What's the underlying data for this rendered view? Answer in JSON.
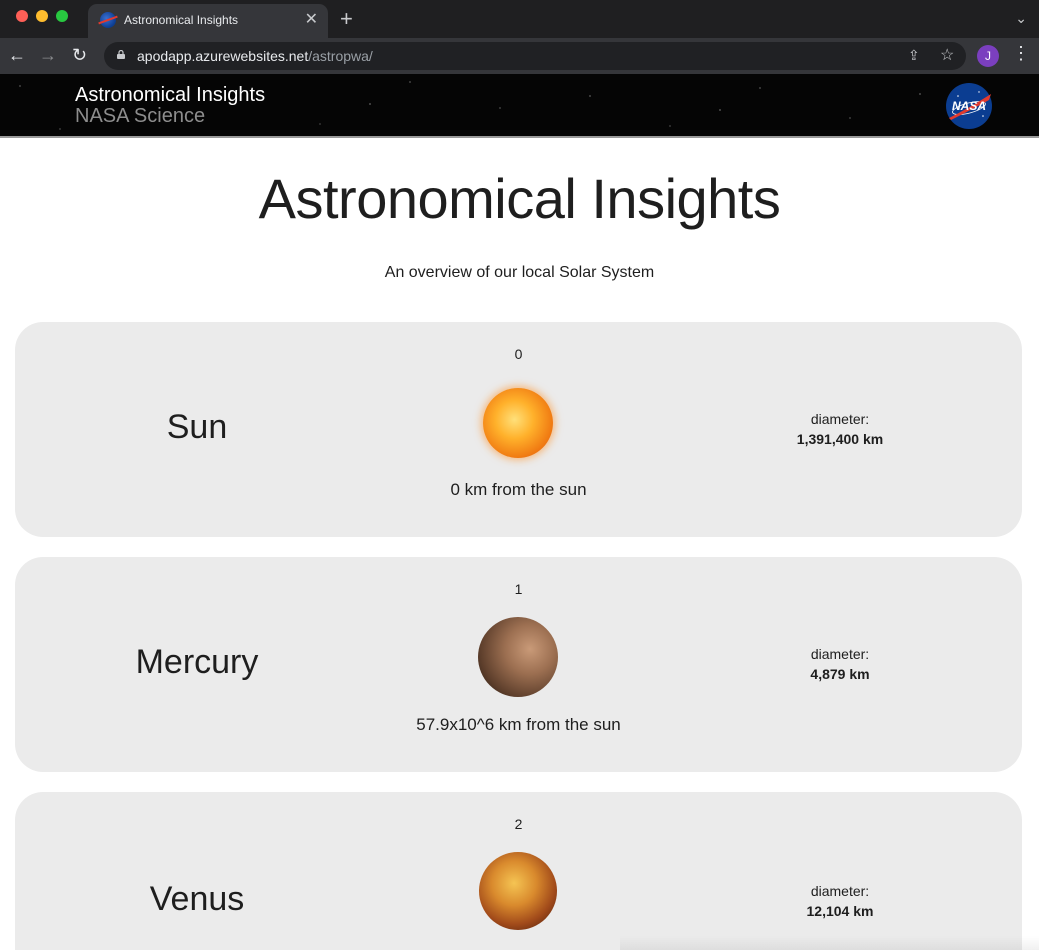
{
  "browser": {
    "tab_title": "Astronomical Insights",
    "url_host": "apodapp.azurewebsites.net",
    "url_path": "/astropwa/",
    "profile_initial": "J"
  },
  "header": {
    "title": "Astronomical Insights",
    "subtitle": "NASA Science",
    "logo_text": "NASA"
  },
  "page": {
    "title": "Astronomical Insights",
    "subtitle": "An overview of our local Solar System"
  },
  "bodies": [
    {
      "index": "0",
      "name": "Sun",
      "distance": "0 km from the sun",
      "diameter_label": "diameter:",
      "diameter": "1,391,400 km"
    },
    {
      "index": "1",
      "name": "Mercury",
      "distance": "57.9x10^6 km from the sun",
      "diameter_label": "diameter:",
      "diameter": "4,879 km"
    },
    {
      "index": "2",
      "name": "Venus",
      "distance": "",
      "diameter_label": "diameter:",
      "diameter": "12,104 km"
    }
  ],
  "colors": {
    "card_bg": "#ebebeb",
    "header_bg": "#050505",
    "profile_avatar": "#7b3fbf"
  }
}
